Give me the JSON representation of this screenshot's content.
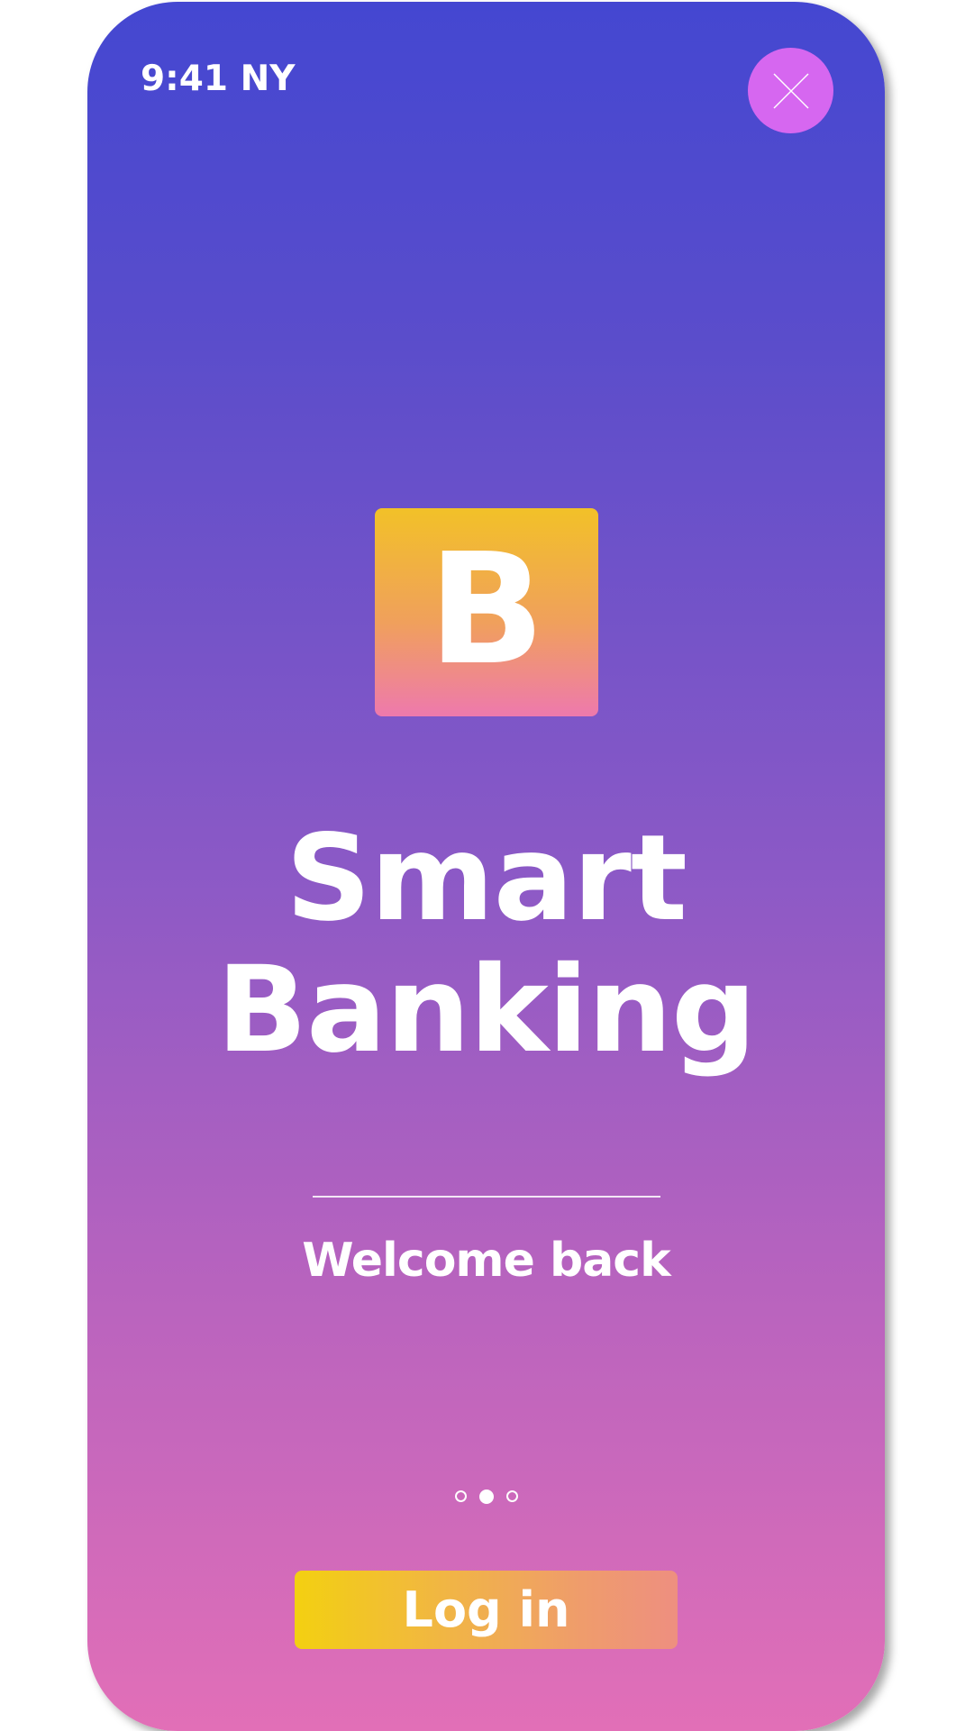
{
  "status_bar": {
    "time_label": "9:41 NY"
  },
  "close_button": {
    "icon": "close-icon"
  },
  "logo": {
    "letter": "B"
  },
  "hero": {
    "title_line1": "Smart",
    "title_line2": "Banking",
    "subtitle": "Welcome back"
  },
  "pager": {
    "count": 3,
    "active_index": 1
  },
  "actions": {
    "login_label": "Log in"
  },
  "colors": {
    "gradient_top": "#4447d1",
    "gradient_bottom": "#e26fb7",
    "close_button_bg": "#d667f0",
    "logo_top": "#f2c128",
    "logo_bottom": "#ee79ad",
    "login_left": "#f3d011",
    "login_right": "#ee8f80"
  }
}
